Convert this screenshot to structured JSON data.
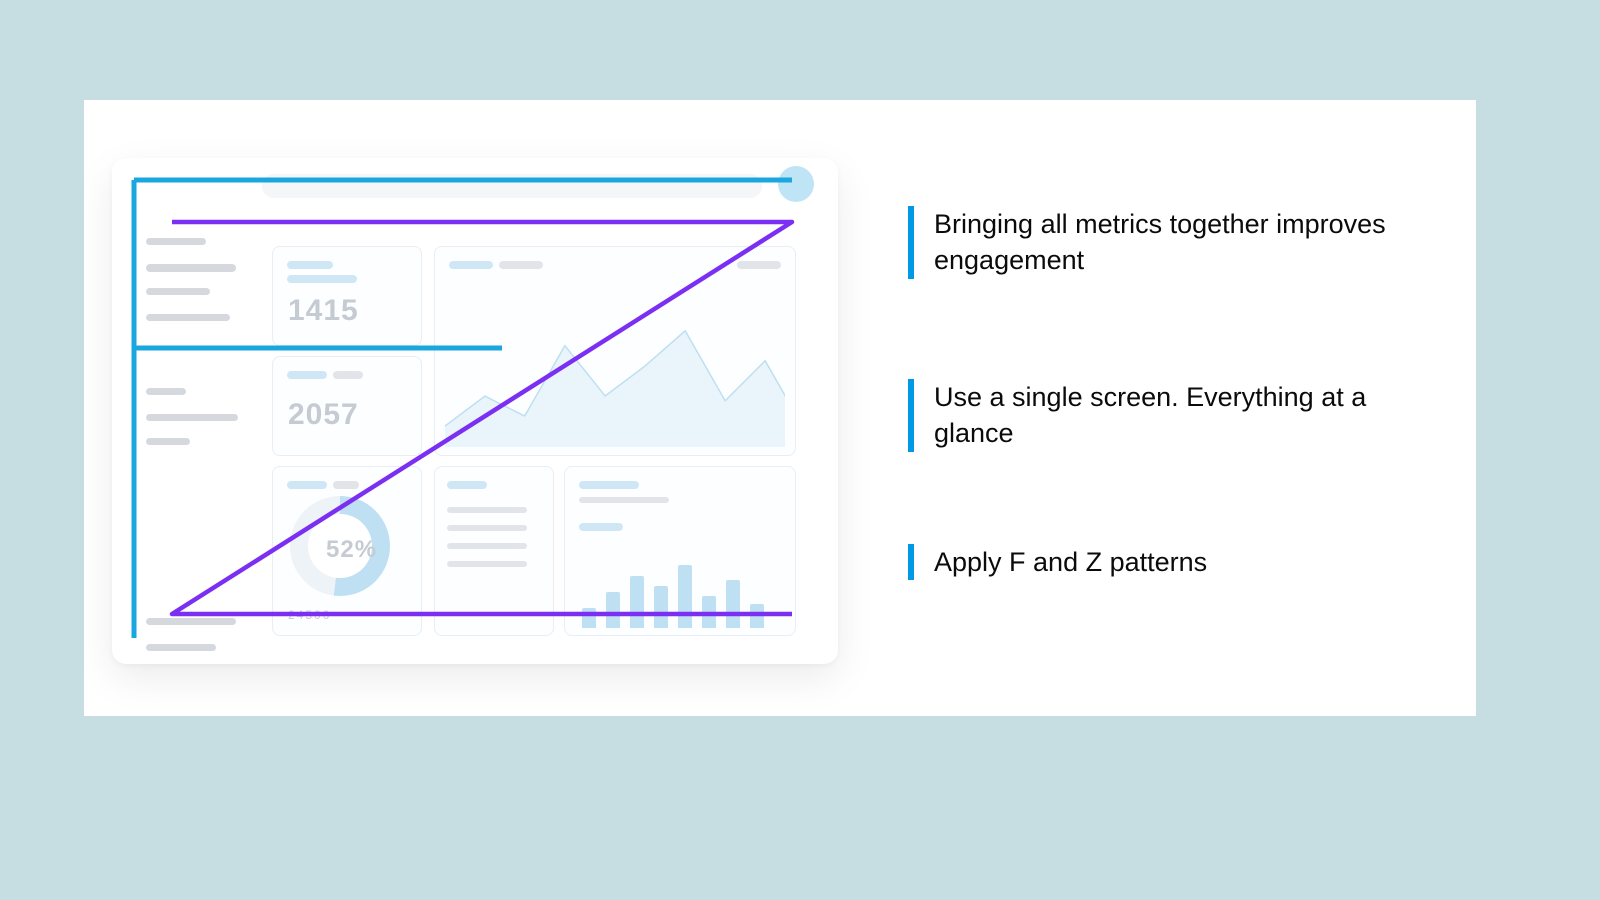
{
  "bullets": [
    "Bringing all metrics together improves engagement",
    "Use a single screen. Everything at a glance",
    "Apply F and Z patterns"
  ],
  "dashboard": {
    "stat1": "1415",
    "stat2": "2057",
    "donut_pct": "52%",
    "tiny_axis": "24500"
  },
  "colors": {
    "accent_blue": "#0099e5",
    "overlay_purple": "#7b2ff2",
    "overlay_cyan": "#1aa7e0"
  }
}
